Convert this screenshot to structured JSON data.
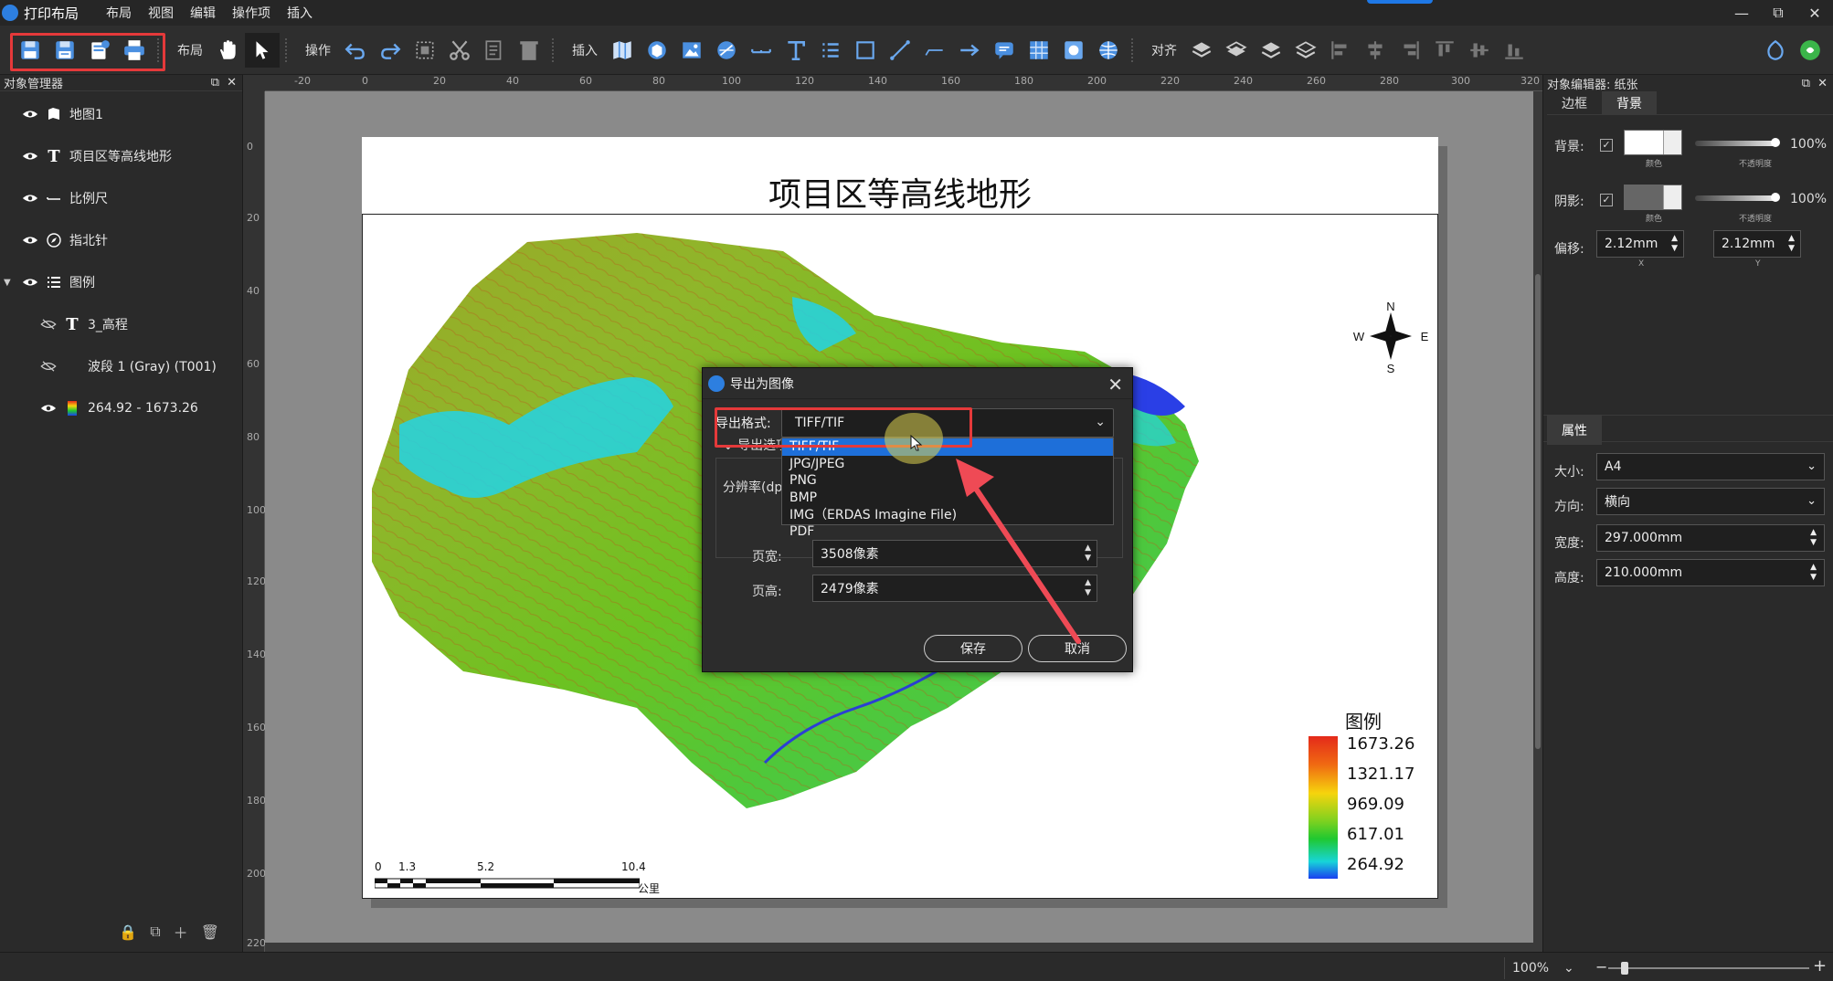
{
  "titlebar": {
    "title": "打印布局",
    "menu": [
      "布局",
      "视图",
      "编辑",
      "操作项",
      "插入"
    ]
  },
  "toolbar": {
    "labels": {
      "layout": "布局",
      "operation": "操作",
      "insert": "插入",
      "align": "对齐"
    }
  },
  "left_panel": {
    "title": "对象管理器",
    "items": [
      {
        "label": "地图1",
        "icon": "map-icon"
      },
      {
        "label": "项目区等高线地形",
        "icon": "text-icon"
      },
      {
        "label": "比例尺",
        "icon": "scalebar-icon"
      },
      {
        "label": "指北针",
        "icon": "compass-icon"
      },
      {
        "label": "图例",
        "icon": "list-icon"
      },
      {
        "label": "3_高程",
        "icon": "text-icon"
      },
      {
        "label": "波段 1 (Gray) (T001)",
        "icon": "band-icon"
      },
      {
        "label": "264.92 - 1673.26",
        "icon": "colorramp-icon"
      }
    ]
  },
  "ruler": {
    "top": [
      "-20",
      "0",
      "20",
      "40",
      "60",
      "80",
      "100",
      "120",
      "140",
      "160",
      "180",
      "200",
      "220",
      "240",
      "260",
      "280",
      "300",
      "320"
    ],
    "left": [
      "0",
      "20",
      "40",
      "60",
      "80",
      "100",
      "120",
      "140",
      "160",
      "180",
      "200",
      "220"
    ]
  },
  "page": {
    "title": "项目区等高线地形",
    "compass": {
      "n": "N",
      "s": "S",
      "e": "E",
      "w": "W"
    },
    "legend": {
      "title": "图例",
      "values": [
        "1673.26",
        "1321.17",
        "969.09",
        "617.01",
        "264.92"
      ]
    },
    "scalebar": {
      "labels": [
        "0",
        "1.3",
        "5.2",
        "10.4"
      ],
      "unit": "公里"
    }
  },
  "dialog": {
    "title": "导出为图像",
    "format_label": "导出格式:",
    "format_value": "TIFF/TIF",
    "options": [
      "TIFF/TIF",
      "JPG/JPEG",
      "PNG",
      "BMP",
      "IMG（ERDAS Imagine File)",
      "PDF"
    ],
    "export_options_label": "导出选项",
    "resolution_label": "分辨率(dpi)",
    "page_width_label": "页宽:",
    "page_width_value": "3508像素",
    "page_height_label": "页高:",
    "page_height_value": "2479像素",
    "save": "保存",
    "cancel": "取消"
  },
  "right_panel": {
    "title": "对象编辑器: 纸张",
    "tabs": [
      "边框",
      "背景"
    ],
    "background_label": "背景:",
    "shadow_label": "阴影:",
    "offset_label": "偏移:",
    "color_caption": "颜色",
    "opacity_caption": "不透明度",
    "bg_opacity": "100%",
    "shadow_opacity": "100%",
    "offset_x": "2.12mm",
    "offset_y": "2.12mm",
    "x_caption": "X",
    "y_caption": "Y",
    "props_tab": "属性",
    "size_label": "大小:",
    "size_value": "A4",
    "orient_label": "方向:",
    "orient_value": "横向",
    "width_label": "宽度:",
    "width_value": "297.000mm",
    "height_label": "高度:",
    "height_value": "210.000mm"
  },
  "statusbar": {
    "zoom": "100%"
  },
  "colors": {
    "accent": "#1e6fd9",
    "highlight": "#e5393a",
    "arrow": "#ef4a55"
  }
}
